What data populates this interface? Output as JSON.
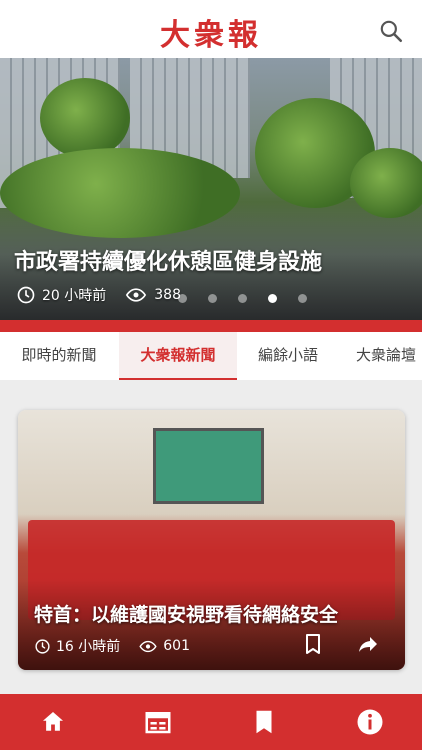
{
  "header": {
    "logo_text": "大衆報",
    "search_icon": "search-icon"
  },
  "hero": {
    "title": "市政署持續優化休憩區健身設施",
    "time_text": "20 小時前",
    "views": "388",
    "carousel_total": 5,
    "carousel_active_index": 3
  },
  "tabs": [
    {
      "label": "即時的新聞",
      "active": false
    },
    {
      "label": "大衆報新聞",
      "active": true
    },
    {
      "label": "編餘小語",
      "active": false
    },
    {
      "label": "大衆論壇",
      "active": false
    }
  ],
  "card": {
    "title": "特首：以維護國安視野看待網絡安全",
    "time_text": "16 小時前",
    "views": "601",
    "bookmark_icon": "bookmark-icon",
    "share_icon": "share-icon"
  },
  "bottom_nav": [
    {
      "icon": "home-icon"
    },
    {
      "icon": "calendar-icon"
    },
    {
      "icon": "bookmark-icon"
    },
    {
      "icon": "info-icon"
    }
  ],
  "colors": {
    "brand_red": "#d32f2f",
    "tab_active_bg": "#f7eeee",
    "page_bg": "#ededed"
  }
}
